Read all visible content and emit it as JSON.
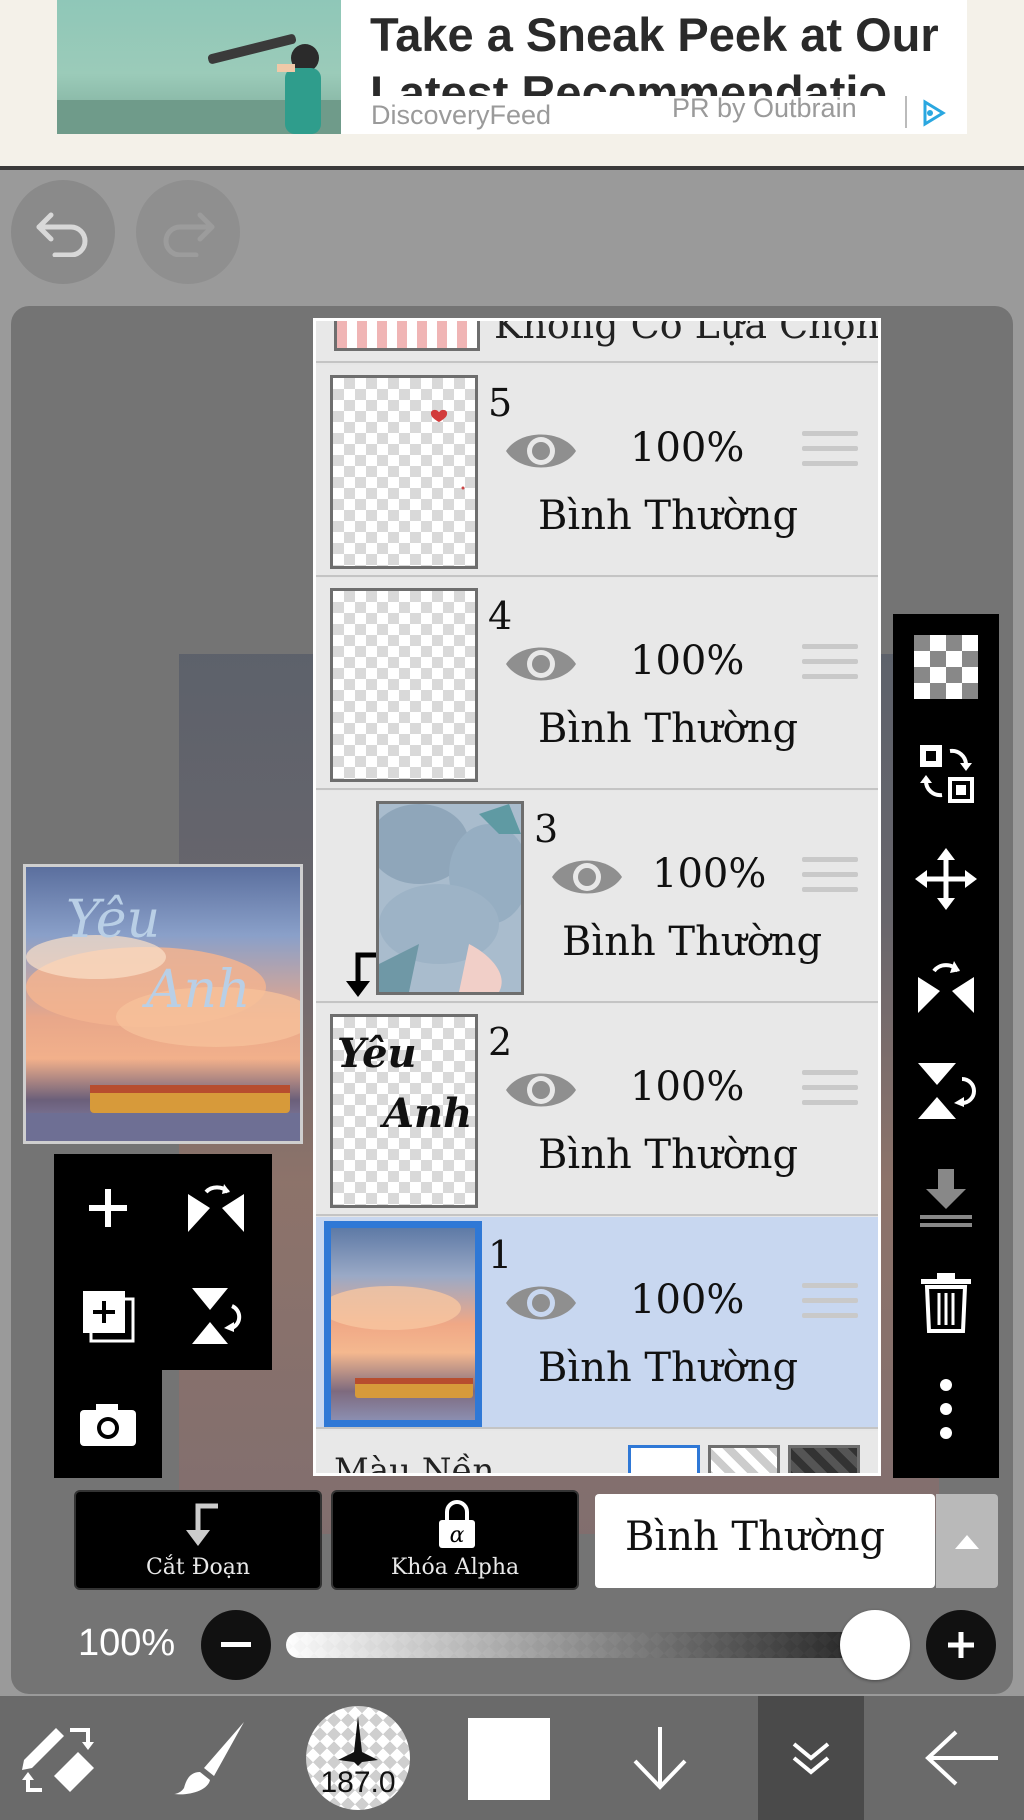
{
  "ad": {
    "title_line1": "Take a Sneak Peek at Our",
    "title_line2": "Latest Recommendatio",
    "source": "DiscoveryFeed",
    "pr": "PR by Outbrain"
  },
  "layers": {
    "top_partial_label": "Không Có Lựa Chọn",
    "items": [
      {
        "number": "5",
        "opacity": "100%",
        "blend": "Bình Thường"
      },
      {
        "number": "4",
        "opacity": "100%",
        "blend": "Bình Thường"
      },
      {
        "number": "3",
        "opacity": "100%",
        "blend": "Bình Thường"
      },
      {
        "number": "2",
        "opacity": "100%",
        "blend": "Bình Thường"
      },
      {
        "number": "1",
        "opacity": "100%",
        "blend": "Bình Thường"
      }
    ],
    "background_label": "Màu Nền"
  },
  "controls": {
    "clipping_label": "Cắt Đoạn",
    "alpha_lock_label": "Khóa Alpha",
    "blend_mode": "Bình Thường",
    "opacity_label": "100%",
    "opacity_value": 1.0
  },
  "bottom_nav": {
    "brush_size": "187.0"
  },
  "colors": {
    "selected_layer": "#c8d7f0",
    "selected_border": "#2f78d6",
    "toolbar": "#000000"
  }
}
